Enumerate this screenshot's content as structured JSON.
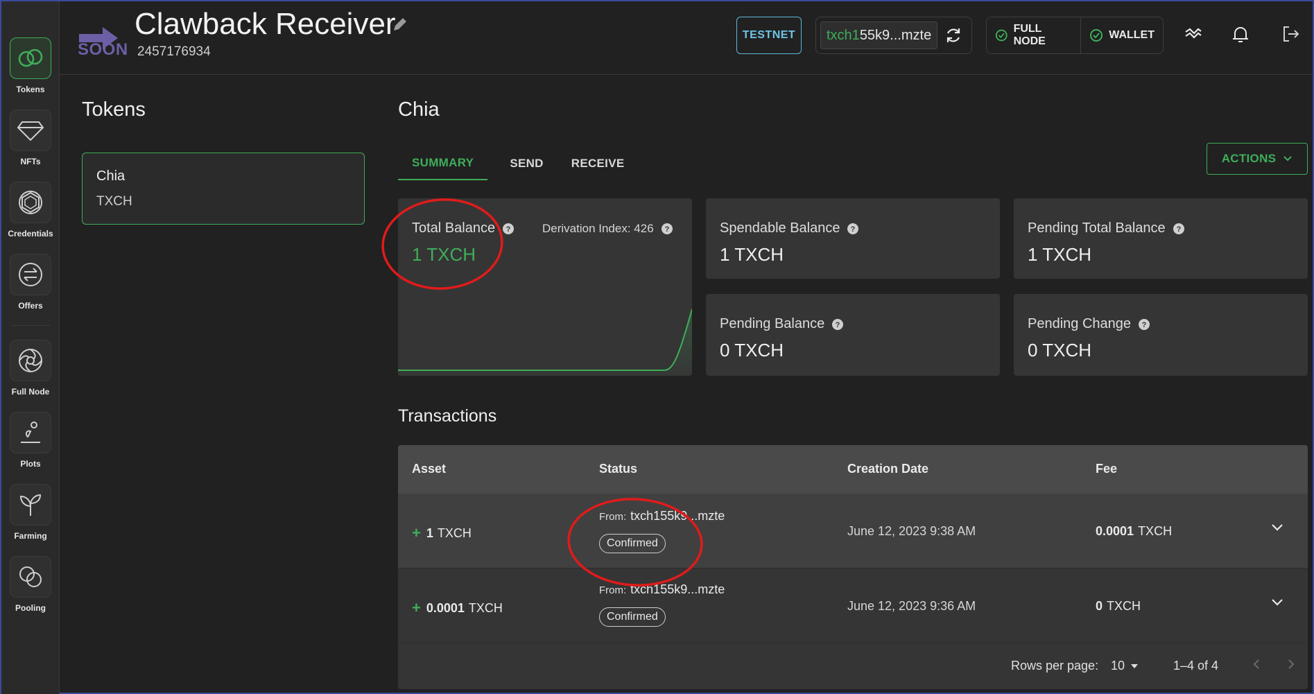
{
  "sidebar": {
    "items": [
      {
        "label": "Tokens",
        "icon": "tokens-icon",
        "active": true
      },
      {
        "label": "NFTs",
        "icon": "nft-diamond-icon"
      },
      {
        "label": "Credentials",
        "icon": "credentials-icon"
      },
      {
        "label": "Offers",
        "icon": "offers-swap-icon"
      },
      {
        "label": "Full Node",
        "icon": "full-node-icon"
      },
      {
        "label": "Plots",
        "icon": "plots-icon"
      },
      {
        "label": "Farming",
        "icon": "farming-sprout-icon"
      },
      {
        "label": "Pooling",
        "icon": "pooling-icon"
      }
    ]
  },
  "header": {
    "logo_text": "SOON",
    "wallet_name": "Clawback Receiver",
    "fingerprint": "2457176934",
    "network": "TESTNET",
    "address_prefix": "txch1",
    "address_rest": "55k9...mzte",
    "full_node_label": "FULL NODE",
    "wallet_label": "WALLET"
  },
  "tokens_panel": {
    "title": "Tokens",
    "selected": {
      "name": "Chia",
      "symbol": "TXCH"
    }
  },
  "main": {
    "title": "Chia",
    "tabs": [
      {
        "label": "SUMMARY",
        "active": true
      },
      {
        "label": "SEND"
      },
      {
        "label": "RECEIVE"
      }
    ],
    "actions_label": "ACTIONS",
    "cards": {
      "total": {
        "label": "Total Balance",
        "value": "1 TXCH",
        "derivation": "Derivation Index: 426"
      },
      "spendable": {
        "label": "Spendable Balance",
        "value": "1 TXCH"
      },
      "pending_total": {
        "label": "Pending Total Balance",
        "value": "1 TXCH"
      },
      "pending": {
        "label": "Pending Balance",
        "value": "0 TXCH"
      },
      "pending_change": {
        "label": "Pending Change",
        "value": "0 TXCH"
      }
    }
  },
  "transactions": {
    "title": "Transactions",
    "columns": [
      "Asset",
      "Status",
      "Creation Date",
      "Fee"
    ],
    "rows": [
      {
        "amount": "1",
        "unit": "TXCH",
        "from_label": "From:",
        "from": "txch155k9...mzte",
        "status": "Confirmed",
        "date": "June 12, 2023 9:38 AM",
        "fee": "0.0001",
        "fee_unit": "TXCH"
      },
      {
        "amount": "0.0001",
        "unit": "TXCH",
        "from_label": "From:",
        "from": "txch155k9...mzte",
        "status": "Confirmed",
        "date": "June 12, 2023 9:36 AM",
        "fee": "0",
        "fee_unit": "TXCH"
      }
    ],
    "footer": {
      "rows_per_page_label": "Rows per page:",
      "rows_per_page": "10",
      "range": "1–4 of 4"
    }
  },
  "colors": {
    "accent": "#3fae5a",
    "testnet": "#6fc6e8",
    "annotation": "#e01b1b",
    "logo": "#6d5fa6"
  }
}
